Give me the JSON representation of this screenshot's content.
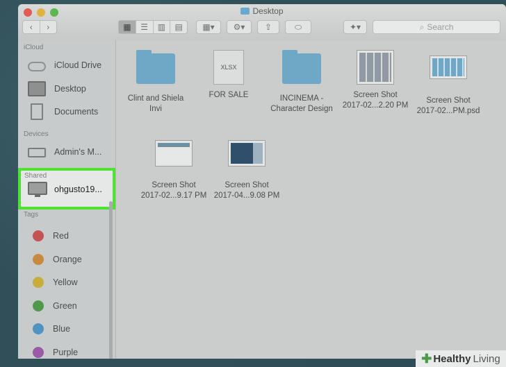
{
  "window": {
    "title": "Desktop"
  },
  "toolbar": {
    "search_placeholder": "Search"
  },
  "sidebar": {
    "icloud_header": "iCloud",
    "icloud_items": [
      {
        "label": "iCloud Drive",
        "icon": "cloud-icon"
      },
      {
        "label": "Desktop",
        "icon": "desktop-icon"
      },
      {
        "label": "Documents",
        "icon": "documents-icon"
      }
    ],
    "devices_header": "Devices",
    "devices_items": [
      {
        "label": "Admin's M...",
        "icon": "laptop-icon"
      }
    ],
    "shared_header": "Shared",
    "shared_items": [
      {
        "label": "ohgusto19...",
        "icon": "monitor-icon"
      }
    ],
    "tags_header": "Tags",
    "tags": [
      {
        "label": "Red",
        "color": "#c65353"
      },
      {
        "label": "Orange",
        "color": "#c98a40"
      },
      {
        "label": "Yellow",
        "color": "#c9ad3c"
      },
      {
        "label": "Green",
        "color": "#4f9a4a"
      },
      {
        "label": "Blue",
        "color": "#4e93c2"
      },
      {
        "label": "Purple",
        "color": "#9a5aa8"
      }
    ]
  },
  "files": [
    {
      "line1": "Clint and Shiela",
      "line2": "Invi",
      "kind": "folder"
    },
    {
      "line1": "FOR SALE",
      "line2": "",
      "kind": "xlsx",
      "badge": "XLSX"
    },
    {
      "line1": "INCINEMA -",
      "line2": "Character Design",
      "kind": "folder"
    },
    {
      "line1": "Screen Shot",
      "line2": "2017-02...2.20 PM",
      "kind": "screenshot"
    },
    {
      "line1": "Screen Shot",
      "line2": "2017-02...PM.psd",
      "kind": "screenshot"
    },
    {
      "line1": "Screen Shot",
      "line2": "2017-02...9.17 PM",
      "kind": "screenshot"
    },
    {
      "line1": "Screen Shot",
      "line2": "2017-04...9.08 PM",
      "kind": "screenshot"
    }
  ],
  "watermark": {
    "brand": "Healthy",
    "brand2": "Living"
  }
}
